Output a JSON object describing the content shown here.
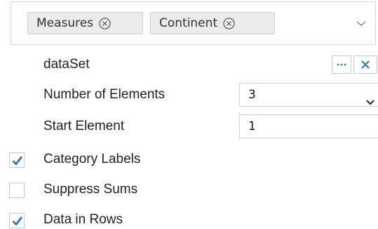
{
  "tags": {
    "items": [
      {
        "label": "Measures"
      },
      {
        "label": "Continent"
      }
    ],
    "remove_icon": "circle-x-icon",
    "toggle_icon": "chevron-down-icon"
  },
  "dataset": {
    "label": "dataSet",
    "browse_icon": "ellipsis-icon",
    "clear_icon": "close-icon"
  },
  "number_of_elements": {
    "label": "Number of Elements",
    "value": "3"
  },
  "start_element": {
    "label": "Start Element",
    "value": "1"
  },
  "options": [
    {
      "label": "Category Labels",
      "checked": true
    },
    {
      "label": "Suppress Sums",
      "checked": false
    },
    {
      "label": "Data in Rows",
      "checked": true
    }
  ],
  "colors": {
    "accent": "#1a7fc1",
    "chip_bg": "#ebebeb"
  }
}
